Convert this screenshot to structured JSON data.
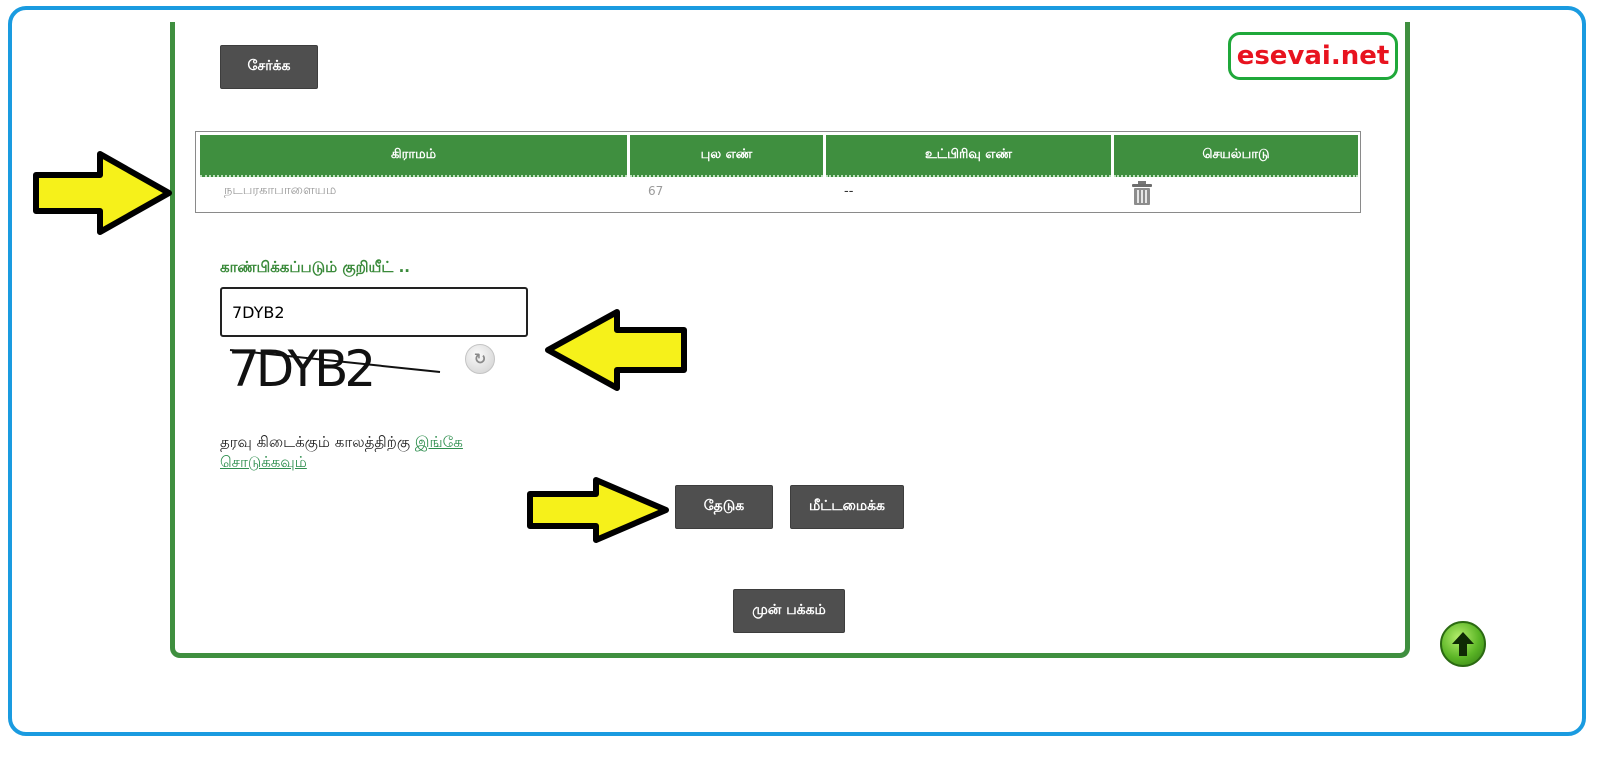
{
  "brand": {
    "text": "esevai.net"
  },
  "buttons": {
    "add": "சேர்க்க",
    "search": "தேடுக",
    "reset": "மீட்டமைக்க",
    "previous": "முன் பக்கம்"
  },
  "table": {
    "headers": [
      "கிராமம்",
      "புல எண்",
      "உட்பிரிவு எண்",
      "செயல்பாடு"
    ],
    "rows": [
      {
        "village": "நடபரகாபாளையம",
        "survey_no": "67",
        "subdivision": "--",
        "action_icon": "trash-icon"
      }
    ]
  },
  "captcha": {
    "label": "காண்பிக்கப்படும் குறியீட் ..",
    "input_value": "7DYB2",
    "image_text": "7DYB2",
    "refresh_icon": "refresh-icon"
  },
  "notice": {
    "text": "தரவு கிடைக்கும் காலத்திற்கு",
    "link": "இங்கே சொடுக்கவும்"
  },
  "colors": {
    "accent_green": "#3f8f3f",
    "frame_blue": "#1a9be0",
    "brand_red": "#e8131f",
    "button_gray": "#4f4f4f",
    "arrow_yellow": "#f6f11a"
  }
}
